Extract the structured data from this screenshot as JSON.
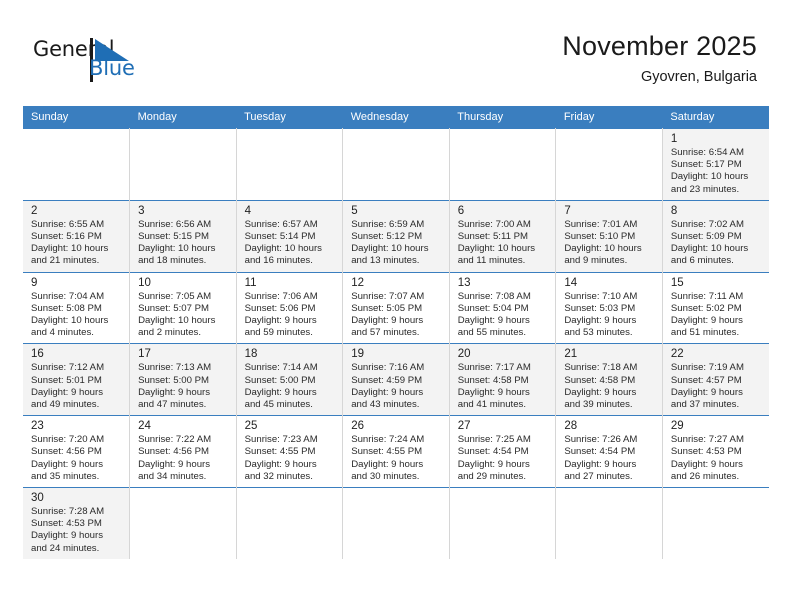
{
  "brand": {
    "name_top": "General",
    "name_bottom": "Blue",
    "color_primary": "#1f6eb5",
    "color_text": "#1a1a1a",
    "flag_icon": "triangle-flag-icon"
  },
  "header": {
    "title": "November 2025",
    "subtitle": "Gyovren, Bulgaria"
  },
  "theme": {
    "header_bg": "#3a7ebf",
    "header_text": "#ffffff",
    "shaded_cell": "#f3f3f3",
    "grid_line": "#d6d6d6",
    "row_line": "#3a7ebf"
  },
  "calendar": {
    "weekday_headers": [
      "Sunday",
      "Monday",
      "Tuesday",
      "Wednesday",
      "Thursday",
      "Friday",
      "Saturday"
    ],
    "labels": {
      "sunrise": "Sunrise:",
      "sunset": "Sunset:",
      "daylight": "Daylight:"
    },
    "weeks": [
      [
        {
          "day": "",
          "empty": true
        },
        {
          "day": "",
          "empty": true
        },
        {
          "day": "",
          "empty": true
        },
        {
          "day": "",
          "empty": true
        },
        {
          "day": "",
          "empty": true
        },
        {
          "day": "",
          "empty": true
        },
        {
          "day": "1",
          "sunrise": "Sunrise: 6:54 AM",
          "sunset": "Sunset: 5:17 PM",
          "daylight_line1": "Daylight: 10 hours",
          "daylight_line2": "and 23 minutes.",
          "shaded": true
        }
      ],
      [
        {
          "day": "2",
          "sunrise": "Sunrise: 6:55 AM",
          "sunset": "Sunset: 5:16 PM",
          "daylight_line1": "Daylight: 10 hours",
          "daylight_line2": "and 21 minutes.",
          "shaded": true
        },
        {
          "day": "3",
          "sunrise": "Sunrise: 6:56 AM",
          "sunset": "Sunset: 5:15 PM",
          "daylight_line1": "Daylight: 10 hours",
          "daylight_line2": "and 18 minutes.",
          "shaded": true
        },
        {
          "day": "4",
          "sunrise": "Sunrise: 6:57 AM",
          "sunset": "Sunset: 5:14 PM",
          "daylight_line1": "Daylight: 10 hours",
          "daylight_line2": "and 16 minutes.",
          "shaded": true
        },
        {
          "day": "5",
          "sunrise": "Sunrise: 6:59 AM",
          "sunset": "Sunset: 5:12 PM",
          "daylight_line1": "Daylight: 10 hours",
          "daylight_line2": "and 13 minutes.",
          "shaded": true
        },
        {
          "day": "6",
          "sunrise": "Sunrise: 7:00 AM",
          "sunset": "Sunset: 5:11 PM",
          "daylight_line1": "Daylight: 10 hours",
          "daylight_line2": "and 11 minutes.",
          "shaded": true
        },
        {
          "day": "7",
          "sunrise": "Sunrise: 7:01 AM",
          "sunset": "Sunset: 5:10 PM",
          "daylight_line1": "Daylight: 10 hours",
          "daylight_line2": "and 9 minutes.",
          "shaded": true
        },
        {
          "day": "8",
          "sunrise": "Sunrise: 7:02 AM",
          "sunset": "Sunset: 5:09 PM",
          "daylight_line1": "Daylight: 10 hours",
          "daylight_line2": "and 6 minutes.",
          "shaded": true
        }
      ],
      [
        {
          "day": "9",
          "sunrise": "Sunrise: 7:04 AM",
          "sunset": "Sunset: 5:08 PM",
          "daylight_line1": "Daylight: 10 hours",
          "daylight_line2": "and 4 minutes.",
          "shaded": false
        },
        {
          "day": "10",
          "sunrise": "Sunrise: 7:05 AM",
          "sunset": "Sunset: 5:07 PM",
          "daylight_line1": "Daylight: 10 hours",
          "daylight_line2": "and 2 minutes.",
          "shaded": false
        },
        {
          "day": "11",
          "sunrise": "Sunrise: 7:06 AM",
          "sunset": "Sunset: 5:06 PM",
          "daylight_line1": "Daylight: 9 hours",
          "daylight_line2": "and 59 minutes.",
          "shaded": false
        },
        {
          "day": "12",
          "sunrise": "Sunrise: 7:07 AM",
          "sunset": "Sunset: 5:05 PM",
          "daylight_line1": "Daylight: 9 hours",
          "daylight_line2": "and 57 minutes.",
          "shaded": false
        },
        {
          "day": "13",
          "sunrise": "Sunrise: 7:08 AM",
          "sunset": "Sunset: 5:04 PM",
          "daylight_line1": "Daylight: 9 hours",
          "daylight_line2": "and 55 minutes.",
          "shaded": false
        },
        {
          "day": "14",
          "sunrise": "Sunrise: 7:10 AM",
          "sunset": "Sunset: 5:03 PM",
          "daylight_line1": "Daylight: 9 hours",
          "daylight_line2": "and 53 minutes.",
          "shaded": false
        },
        {
          "day": "15",
          "sunrise": "Sunrise: 7:11 AM",
          "sunset": "Sunset: 5:02 PM",
          "daylight_line1": "Daylight: 9 hours",
          "daylight_line2": "and 51 minutes.",
          "shaded": false
        }
      ],
      [
        {
          "day": "16",
          "sunrise": "Sunrise: 7:12 AM",
          "sunset": "Sunset: 5:01 PM",
          "daylight_line1": "Daylight: 9 hours",
          "daylight_line2": "and 49 minutes.",
          "shaded": true
        },
        {
          "day": "17",
          "sunrise": "Sunrise: 7:13 AM",
          "sunset": "Sunset: 5:00 PM",
          "daylight_line1": "Daylight: 9 hours",
          "daylight_line2": "and 47 minutes.",
          "shaded": true
        },
        {
          "day": "18",
          "sunrise": "Sunrise: 7:14 AM",
          "sunset": "Sunset: 5:00 PM",
          "daylight_line1": "Daylight: 9 hours",
          "daylight_line2": "and 45 minutes.",
          "shaded": true
        },
        {
          "day": "19",
          "sunrise": "Sunrise: 7:16 AM",
          "sunset": "Sunset: 4:59 PM",
          "daylight_line1": "Daylight: 9 hours",
          "daylight_line2": "and 43 minutes.",
          "shaded": true
        },
        {
          "day": "20",
          "sunrise": "Sunrise: 7:17 AM",
          "sunset": "Sunset: 4:58 PM",
          "daylight_line1": "Daylight: 9 hours",
          "daylight_line2": "and 41 minutes.",
          "shaded": true
        },
        {
          "day": "21",
          "sunrise": "Sunrise: 7:18 AM",
          "sunset": "Sunset: 4:58 PM",
          "daylight_line1": "Daylight: 9 hours",
          "daylight_line2": "and 39 minutes.",
          "shaded": true
        },
        {
          "day": "22",
          "sunrise": "Sunrise: 7:19 AM",
          "sunset": "Sunset: 4:57 PM",
          "daylight_line1": "Daylight: 9 hours",
          "daylight_line2": "and 37 minutes.",
          "shaded": true
        }
      ],
      [
        {
          "day": "23",
          "sunrise": "Sunrise: 7:20 AM",
          "sunset": "Sunset: 4:56 PM",
          "daylight_line1": "Daylight: 9 hours",
          "daylight_line2": "and 35 minutes.",
          "shaded": false
        },
        {
          "day": "24",
          "sunrise": "Sunrise: 7:22 AM",
          "sunset": "Sunset: 4:56 PM",
          "daylight_line1": "Daylight: 9 hours",
          "daylight_line2": "and 34 minutes.",
          "shaded": false
        },
        {
          "day": "25",
          "sunrise": "Sunrise: 7:23 AM",
          "sunset": "Sunset: 4:55 PM",
          "daylight_line1": "Daylight: 9 hours",
          "daylight_line2": "and 32 minutes.",
          "shaded": false
        },
        {
          "day": "26",
          "sunrise": "Sunrise: 7:24 AM",
          "sunset": "Sunset: 4:55 PM",
          "daylight_line1": "Daylight: 9 hours",
          "daylight_line2": "and 30 minutes.",
          "shaded": false
        },
        {
          "day": "27",
          "sunrise": "Sunrise: 7:25 AM",
          "sunset": "Sunset: 4:54 PM",
          "daylight_line1": "Daylight: 9 hours",
          "daylight_line2": "and 29 minutes.",
          "shaded": false
        },
        {
          "day": "28",
          "sunrise": "Sunrise: 7:26 AM",
          "sunset": "Sunset: 4:54 PM",
          "daylight_line1": "Daylight: 9 hours",
          "daylight_line2": "and 27 minutes.",
          "shaded": false
        },
        {
          "day": "29",
          "sunrise": "Sunrise: 7:27 AM",
          "sunset": "Sunset: 4:53 PM",
          "daylight_line1": "Daylight: 9 hours",
          "daylight_line2": "and 26 minutes.",
          "shaded": false
        }
      ],
      [
        {
          "day": "30",
          "sunrise": "Sunrise: 7:28 AM",
          "sunset": "Sunset: 4:53 PM",
          "daylight_line1": "Daylight: 9 hours",
          "daylight_line2": "and 24 minutes.",
          "shaded": true
        },
        {
          "day": "",
          "empty": true
        },
        {
          "day": "",
          "empty": true
        },
        {
          "day": "",
          "empty": true
        },
        {
          "day": "",
          "empty": true
        },
        {
          "day": "",
          "empty": true
        },
        {
          "day": "",
          "empty": true
        }
      ]
    ]
  }
}
